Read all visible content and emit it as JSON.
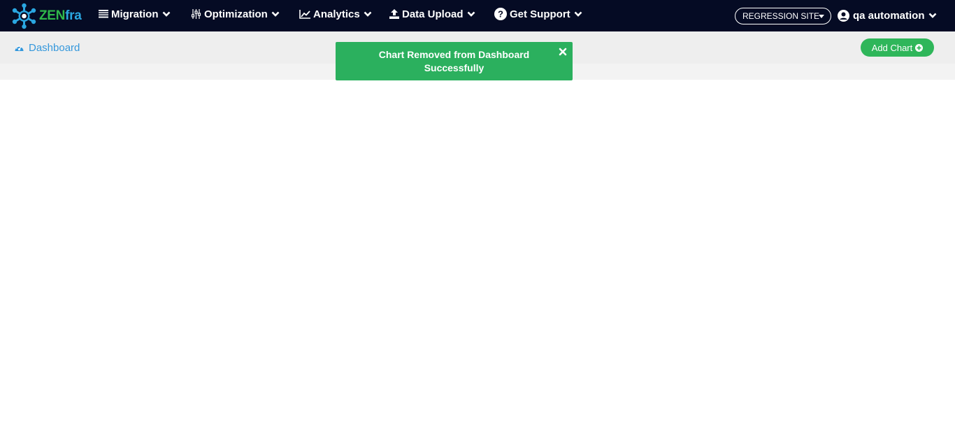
{
  "app": {
    "logo_zen": "ZEN",
    "logo_fra": "fra"
  },
  "nav": [
    {
      "label": "Migration",
      "icon": "list-icon"
    },
    {
      "label": "Optimization",
      "icon": "sliders-icon"
    },
    {
      "label": "Analytics",
      "icon": "line-chart-icon"
    },
    {
      "label": "Data Upload",
      "icon": "upload-icon"
    },
    {
      "label": "Get Support",
      "icon": "question-circle-icon"
    }
  ],
  "site_select": {
    "value": "REGRESSION SITE"
  },
  "user": {
    "name": "qa automation",
    "icon": "user-circle-icon"
  },
  "breadcrumb": {
    "label": "Dashboard",
    "icon": "dashboard-gauge-icon"
  },
  "add_chart": {
    "label": "Add Chart",
    "icon": "plus-circle-icon"
  },
  "toast": {
    "message": "Chart Removed from Dashboard Successfully",
    "icon": "close-icon"
  },
  "colors": {
    "topbar": "#050b24",
    "accent_green": "#2fb65a",
    "link_blue": "#3598dc"
  }
}
